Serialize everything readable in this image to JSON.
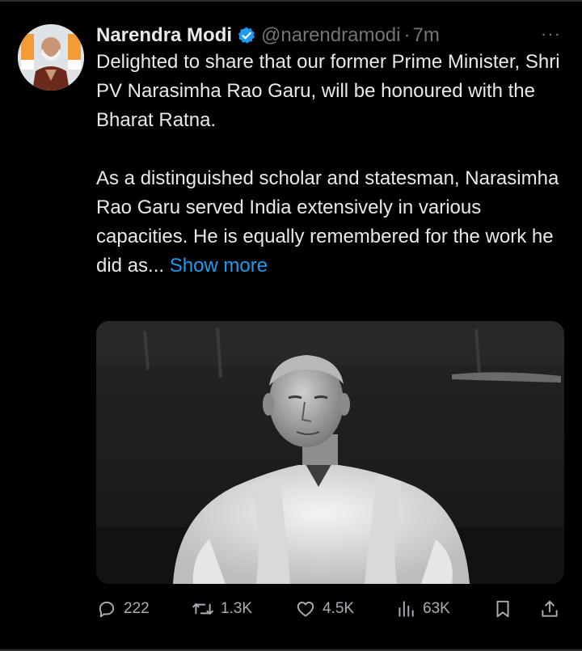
{
  "tweet": {
    "author": {
      "name": "Narendra Modi",
      "handle": "@narendramodi",
      "separator": "·",
      "time": "7m",
      "verified": true
    },
    "text": {
      "paragraph1": "Delighted to share that our former Prime Minister, Shri PV Narasimha Rao Garu, will be honoured with the Bharat Ratna.",
      "paragraph2": "As a distinguished scholar and statesman, Narasimha Rao Garu served India extensively in various capacities. He is equally remembered for the work he did as...",
      "show_more": "Show more"
    },
    "more_menu": "···",
    "actions": {
      "replies": "222",
      "reposts": "1.3K",
      "likes": "4.5K",
      "views": "63K"
    }
  },
  "icons": {
    "verified": "verified-badge-icon",
    "reply": "speech-bubble-icon",
    "repost": "repost-arrows-icon",
    "like": "heart-icon",
    "views": "bar-chart-icon",
    "bookmark": "bookmark-icon",
    "share": "share-upload-icon"
  },
  "colors": {
    "background": "#000000",
    "text": "#e7e9ea",
    "secondary": "#71767b",
    "link": "#1d9bf0",
    "verified": "#1d9bf0"
  }
}
